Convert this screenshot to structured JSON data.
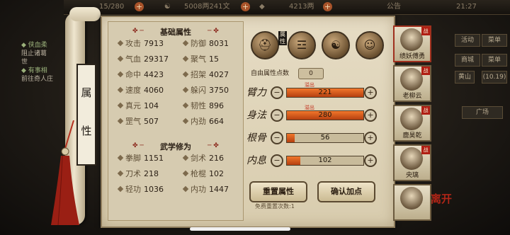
{
  "status": {
    "clock": "21:27"
  },
  "topbar": {
    "energy": "15/280",
    "money": "5008两241文",
    "ingots": "4213两",
    "notice": "公告"
  },
  "side_quests": [
    {
      "title": "侠血柔",
      "desc": "阻止诸葛",
      "desc2": "世"
    },
    {
      "title": "有事相",
      "desc": "前往奇人庄"
    }
  ],
  "side_menu": {
    "activity": "活动",
    "ranking": "菜单",
    "shop": "商城",
    "chat": "菜单",
    "location": "黄山",
    "level": "(10.19)",
    "scene": "广场"
  },
  "scroll_title": [
    "属",
    "性"
  ],
  "base_attrs_title": "基础属性",
  "base_attrs": [
    {
      "label": "攻击",
      "value": "7913"
    },
    {
      "label": "防御",
      "value": "8031"
    },
    {
      "label": "气血",
      "value": "29317"
    },
    {
      "label": "聚气",
      "value": "15"
    },
    {
      "label": "命中",
      "value": "4423"
    },
    {
      "label": "招架",
      "value": "4027"
    },
    {
      "label": "速度",
      "value": "4060"
    },
    {
      "label": "躲闪",
      "value": "3750"
    },
    {
      "label": "真元",
      "value": "104"
    },
    {
      "label": "韧性",
      "value": "896"
    },
    {
      "label": "罡气",
      "value": "507"
    },
    {
      "label": "内劲",
      "value": "664"
    }
  ],
  "martial_title": "武学修为",
  "martial_attrs": [
    {
      "label": "拳脚",
      "value": "1151"
    },
    {
      "label": "剑术",
      "value": "216"
    },
    {
      "label": "刀术",
      "value": "218"
    },
    {
      "label": "枪棍",
      "value": "102"
    },
    {
      "label": "轻功",
      "value": "1036"
    },
    {
      "label": "内功",
      "value": "1447"
    }
  ],
  "free_points_label": "自由属性点数",
  "free_points_value": "0",
  "point_attrs": [
    {
      "name": "臂力",
      "value": "221",
      "fill": 1.0,
      "overflow": "溢出"
    },
    {
      "name": "身法",
      "value": "280",
      "fill": 1.0,
      "overflow": "溢出"
    },
    {
      "name": "根骨",
      "value": "56",
      "fill": 0.1,
      "overflow": ""
    },
    {
      "name": "内息",
      "value": "102",
      "fill": 0.18,
      "overflow": ""
    }
  ],
  "buttons": {
    "reset": "重置属性",
    "confirm": "确认加点",
    "reset_count": "免费重置次数:1"
  },
  "portraits": [
    {
      "name": "绩妖傅勇",
      "badge": "战"
    },
    {
      "name": "老柳云",
      "badge": "战"
    },
    {
      "name": "鹿昊乾",
      "badge": "战"
    },
    {
      "name": "央璃",
      "badge": "战"
    },
    {
      "name": "",
      "badge": ""
    }
  ],
  "leave_label": "离开",
  "colors": {
    "accent": "#b02517",
    "bar_fill": "#f2772b",
    "parchment": "#e6dcc4"
  }
}
